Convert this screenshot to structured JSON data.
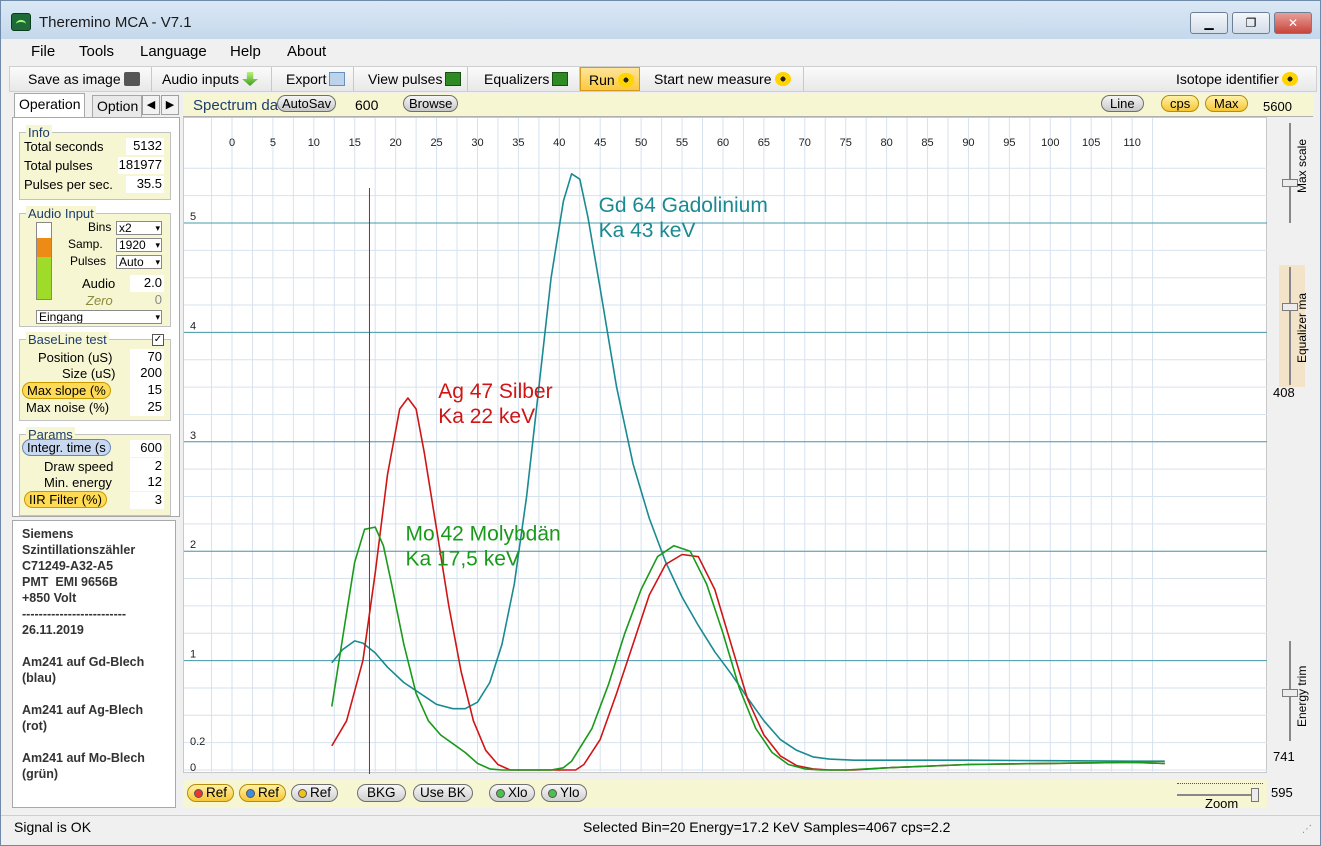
{
  "window": {
    "title": "Theremino MCA - V7.1",
    "minimize": "▁",
    "maximize": "❐",
    "close": "✕"
  },
  "menu": [
    "File",
    "Tools",
    "Language",
    "Help",
    "About"
  ],
  "toolbar": {
    "save_image": "Save as image",
    "audio_inputs": "Audio inputs",
    "export": "Export",
    "view_pulses": "View pulses",
    "equalizers": "Equalizers",
    "run": "Run",
    "start_new_measure": "Start new measure",
    "isotope_identifier": "Isotope identifier"
  },
  "tabs": {
    "operation": "Operation",
    "options": "Option",
    "prev": "◀",
    "next": "▶"
  },
  "info": {
    "label": "Info",
    "total_seconds_label": "Total seconds",
    "total_seconds": "5132",
    "total_pulses_label": "Total pulses",
    "total_pulses": "181977",
    "pps_label": "Pulses per sec.",
    "pps": "35.5"
  },
  "audio_input": {
    "label": "Audio Input",
    "bins_label": "Bins",
    "bins": "x2",
    "samp_label": "Samp.",
    "samp": "1920",
    "pulses_label": "Pulses",
    "pulses": "Auto",
    "audio_label": "Audio",
    "audio": "2.0",
    "zero_label": "Zero",
    "zero": "0",
    "device": "Eingang"
  },
  "baseline": {
    "label": "BaseLine test",
    "check": "✓",
    "position_label": "Position (uS)",
    "position": "70",
    "size_label": "Size (uS)",
    "size": "200",
    "max_slope_label": "Max slope (%",
    "max_slope": "15",
    "max_noise_label": "Max noise (%)",
    "max_noise": "25"
  },
  "params": {
    "label": "Params",
    "integr_label": "Integr. time (s",
    "integr": "600",
    "draw_speed_label": "Draw speed",
    "draw_speed": "2",
    "min_energy_label": "Min. energy",
    "min_energy": "12",
    "iir_label": "IIR Filter (%)",
    "iir": "3"
  },
  "notes": "Siemens\nSzintillationszähler\nC71249-A32-A5\nPMT  EMI 9656B\n+850 Volt\n-------------------------\n26.11.2019\n\nAm241 auf Gd-Blech\n(blau)\n\nAm241 auf Ag-Blech\n(rot)\n\nAm241 auf Mo-Blech\n(grün)",
  "plotbar": {
    "spectrum_label": "Spectrum da",
    "autosave": "AutoSav",
    "autosave_value": "600",
    "browse": "Browse",
    "line": "Line",
    "cps": "cps",
    "max": "Max"
  },
  "right_scale": {
    "max_value": "5600",
    "max_scale": "Max scale",
    "equalizer": "Equalizer ma",
    "equalizer_value": "408",
    "energy_trim": "Energy trim",
    "energy_value": "741",
    "zoom_value": "595",
    "zoom": "Zoom"
  },
  "bottom": {
    "ref1": "Ref",
    "ref2": "Ref",
    "ref3": "Ref",
    "bkg": "BKG",
    "use_bk": "Use BK",
    "xlo": "Xlo",
    "ylo": "Ylo"
  },
  "status": {
    "left": "Signal is OK",
    "center": "Selected Bin=20  Energy=17.2 KeV  Samples=4067  cps=2.2"
  },
  "colors": {
    "blue_curve": "#1a8a92",
    "red_curve": "#d01515",
    "green_curve": "#1a9a1a",
    "grid_major": "#4a9aa8",
    "grid_minor": "#d6e2ee",
    "marker": "#cc1111"
  },
  "chart_data": {
    "type": "line",
    "x_ticks": [
      0,
      5,
      10,
      15,
      20,
      25,
      30,
      35,
      40,
      45,
      50,
      55,
      60,
      65,
      70,
      75,
      80,
      85,
      90,
      95,
      100,
      105,
      110
    ],
    "y_ticks": [
      "0",
      "0.2",
      "1",
      "2",
      "3",
      "4",
      "5"
    ],
    "y_values": [
      0,
      0.2,
      1,
      2,
      3,
      4,
      5
    ],
    "xlim": [
      -2,
      114
    ],
    "ylim": [
      0,
      5.4
    ],
    "marker_x": 16.8,
    "annotations": [
      {
        "line1": "Gd 64  Gadolinium",
        "line2": "Ka  43 keV",
        "color": "#1a8a92",
        "x": 44.8,
        "y": 5.1
      },
      {
        "line1": "Ag 47  Silber",
        "line2": "Ka 22 keV",
        "color": "#d01515",
        "x": 25.2,
        "y": 3.4
      },
      {
        "line1": "Mo 42  Molybdän",
        "line2": "Ka  17,5 keV",
        "color": "#1a9a1a",
        "x": 21.2,
        "y": 2.1
      }
    ],
    "series": [
      {
        "color": "#1a8a92",
        "x": [
          12.2,
          13.5,
          15,
          16,
          17.5,
          19,
          21,
          23,
          25,
          27,
          28.5,
          30,
          31.5,
          33,
          34.5,
          36,
          37.5,
          39,
          40.5,
          41.5,
          42.5,
          43.5,
          45,
          47,
          49,
          51,
          53,
          55,
          57,
          59,
          61,
          63,
          65,
          67,
          69,
          71,
          73,
          76,
          80,
          90,
          100,
          110,
          114
        ],
        "y": [
          0.98,
          1.1,
          1.18,
          1.16,
          1.07,
          0.94,
          0.8,
          0.7,
          0.6,
          0.56,
          0.56,
          0.62,
          0.8,
          1.15,
          1.7,
          2.5,
          3.5,
          4.5,
          5.2,
          5.45,
          5.4,
          5.05,
          4.4,
          3.5,
          2.8,
          2.3,
          1.9,
          1.58,
          1.32,
          1.08,
          0.88,
          0.66,
          0.45,
          0.28,
          0.18,
          0.12,
          0.1,
          0.09,
          0.09,
          0.09,
          0.085,
          0.08,
          0.08
        ]
      },
      {
        "color": "#d01515",
        "x": [
          12.2,
          14,
          16,
          17.5,
          19,
          20.5,
          21.5,
          22.5,
          23.5,
          25,
          26.5,
          28,
          29.5,
          31,
          32.5,
          34,
          36,
          38,
          40,
          41,
          42,
          43,
          45,
          47,
          49,
          51,
          53,
          55,
          57,
          59,
          61,
          63,
          65,
          67,
          69,
          71,
          73,
          76,
          80,
          90,
          100,
          110,
          114
        ],
        "y": [
          0.22,
          0.45,
          1.0,
          1.8,
          2.7,
          3.3,
          3.4,
          3.3,
          2.9,
          2.2,
          1.5,
          0.9,
          0.45,
          0.18,
          0.05,
          0,
          0,
          0,
          0,
          0,
          0,
          0.05,
          0.28,
          0.7,
          1.15,
          1.6,
          1.88,
          1.97,
          1.95,
          1.65,
          1.15,
          0.65,
          0.32,
          0.13,
          0.04,
          0.01,
          0,
          0,
          0.02,
          0.05,
          0.06,
          0.07,
          0.06
        ]
      },
      {
        "color": "#1a9a1a",
        "x": [
          12.2,
          13.5,
          15,
          16.2,
          17.5,
          18.5,
          19.5,
          21,
          22.5,
          24,
          25.5,
          27,
          28.5,
          30,
          31.5,
          33,
          35,
          37,
          39,
          40.5,
          41.5,
          42.5,
          44,
          46,
          48,
          50,
          52,
          54,
          56,
          58,
          60,
          62,
          64,
          66,
          68,
          70,
          72,
          75,
          80,
          90,
          100,
          110,
          114
        ],
        "y": [
          0.58,
          1.2,
          1.9,
          2.2,
          2.22,
          2.05,
          1.7,
          1.15,
          0.7,
          0.45,
          0.32,
          0.24,
          0.16,
          0.06,
          0.01,
          0,
          0,
          0,
          0,
          0.02,
          0.08,
          0.2,
          0.38,
          0.78,
          1.25,
          1.65,
          1.95,
          2.05,
          2.0,
          1.7,
          1.25,
          0.75,
          0.38,
          0.16,
          0.05,
          0.01,
          0,
          0,
          0.02,
          0.05,
          0.06,
          0.07,
          0.06
        ]
      }
    ]
  }
}
